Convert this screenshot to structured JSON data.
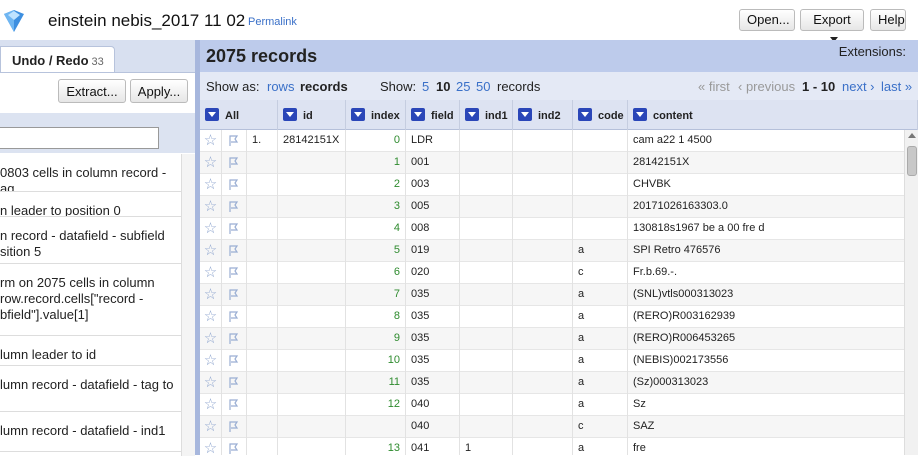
{
  "header": {
    "project_title": "einstein nebis_2017 11 02",
    "permalink": "Permalink",
    "open_label": "Open...",
    "export_label": "Export",
    "help_label": "Help"
  },
  "left_panel": {
    "tab_label": "Undo / Redo",
    "tab_count": "33",
    "extract_label": "Extract...",
    "apply_label": "Apply...",
    "history": [
      "0803 cells in column record -\nag",
      "n leader to position 0",
      "n record - datafield - subfield\nsition 5",
      "rm on 2075 cells in column\nrow.record.cells[\"record -\nbfield\"].value[1]",
      "lumn leader to id",
      "lumn record - datafield - tag to",
      "lumn record - datafield - ind1"
    ]
  },
  "main": {
    "record_count": "2075 records",
    "extensions": "Extensions:",
    "show_as_label": "Show as:",
    "mode_rows": "rows",
    "mode_records": "records",
    "show_label": "Show:",
    "page_sizes": [
      "5",
      "10",
      "25",
      "50"
    ],
    "page_size_suffix": "records",
    "pager": {
      "first": "« first",
      "previous": "‹ previous",
      "range": "1 - 10",
      "next": "next ›",
      "last": "last »"
    }
  },
  "columns": [
    "All",
    "id",
    "index",
    "field",
    "ind1",
    "ind2",
    "code",
    "content"
  ],
  "rows": [
    {
      "rec": "1.",
      "id": "28142151X",
      "index": "0",
      "field": "LDR",
      "ind1": "",
      "ind2": "",
      "code": "",
      "content": "cam a22 1 4500"
    },
    {
      "rec": "",
      "id": "",
      "index": "1",
      "field": "001",
      "ind1": "",
      "ind2": "",
      "code": "",
      "content": "28142151X"
    },
    {
      "rec": "",
      "id": "",
      "index": "2",
      "field": "003",
      "ind1": "",
      "ind2": "",
      "code": "",
      "content": "CHVBK"
    },
    {
      "rec": "",
      "id": "",
      "index": "3",
      "field": "005",
      "ind1": "",
      "ind2": "",
      "code": "",
      "content": "20171026163303.0"
    },
    {
      "rec": "",
      "id": "",
      "index": "4",
      "field": "008",
      "ind1": "",
      "ind2": "",
      "code": "",
      "content": "130818s1967 be a 00 fre d"
    },
    {
      "rec": "",
      "id": "",
      "index": "5",
      "field": "019",
      "ind1": "",
      "ind2": "",
      "code": "a",
      "content": "SPI Retro 476576"
    },
    {
      "rec": "",
      "id": "",
      "index": "6",
      "field": "020",
      "ind1": "",
      "ind2": "",
      "code": "c",
      "content": "Fr.b.69.-."
    },
    {
      "rec": "",
      "id": "",
      "index": "7",
      "field": "035",
      "ind1": "",
      "ind2": "",
      "code": "a",
      "content": "(SNL)vtls000313023"
    },
    {
      "rec": "",
      "id": "",
      "index": "8",
      "field": "035",
      "ind1": "",
      "ind2": "",
      "code": "a",
      "content": "(RERO)R003162939"
    },
    {
      "rec": "",
      "id": "",
      "index": "9",
      "field": "035",
      "ind1": "",
      "ind2": "",
      "code": "a",
      "content": "(RERO)R006453265"
    },
    {
      "rec": "",
      "id": "",
      "index": "10",
      "field": "035",
      "ind1": "",
      "ind2": "",
      "code": "a",
      "content": "(NEBIS)002173556"
    },
    {
      "rec": "",
      "id": "",
      "index": "11",
      "field": "035",
      "ind1": "",
      "ind2": "",
      "code": "a",
      "content": "(Sz)000313023"
    },
    {
      "rec": "",
      "id": "",
      "index": "12",
      "field": "040",
      "ind1": "",
      "ind2": "",
      "code": "a",
      "content": "Sz"
    },
    {
      "rec": "",
      "id": "",
      "index": "",
      "field": "040",
      "ind1": "",
      "ind2": "",
      "code": "c",
      "content": "SAZ"
    },
    {
      "rec": "",
      "id": "",
      "index": "13",
      "field": "041",
      "ind1": "1",
      "ind2": "",
      "code": "a",
      "content": "fre"
    }
  ]
}
